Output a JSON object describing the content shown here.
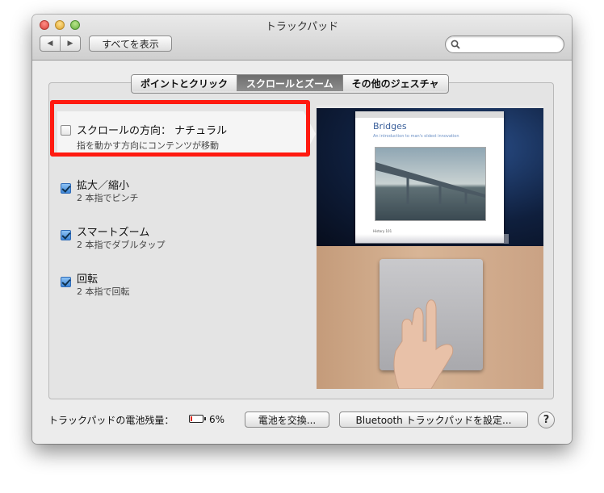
{
  "window": {
    "title": "トラックパッド",
    "show_all_label": "すべてを表示",
    "search": {
      "value": "",
      "placeholder": ""
    }
  },
  "tabs": [
    {
      "label": "ポイントとクリック",
      "active": false
    },
    {
      "label": "スクロールとズーム",
      "active": true
    },
    {
      "label": "その他のジェスチャ",
      "active": false
    }
  ],
  "options": [
    {
      "title": "スクロールの方向： ナチュラル",
      "subtitle": "指を動かす方向にコンテンツが移動",
      "checked": false,
      "selected": true
    },
    {
      "title": "拡大／縮小",
      "subtitle": "2 本指でピンチ",
      "checked": true,
      "selected": false
    },
    {
      "title": "スマートズーム",
      "subtitle": "2 本指でダブルタップ",
      "checked": true,
      "selected": false
    },
    {
      "title": "回転",
      "subtitle": "2 本指で回転",
      "checked": true,
      "selected": false
    }
  ],
  "preview": {
    "doc_title": "Bridges",
    "doc_subtitle": "An introduction to man's oldest innovation",
    "doc_footer": "History 101"
  },
  "footer": {
    "battery_label": "トラックパッドの電池残量：",
    "battery_percent": "6%",
    "battery_level": 0.06,
    "replace_button": "電池を交換...",
    "bluetooth_button": "Bluetooth トラックパッドを設定...",
    "help_label": "?"
  },
  "colors": {
    "highlight": "#ff1a10",
    "checkbox_checked": "#3d85d7",
    "battery_low": "#e0261b"
  }
}
